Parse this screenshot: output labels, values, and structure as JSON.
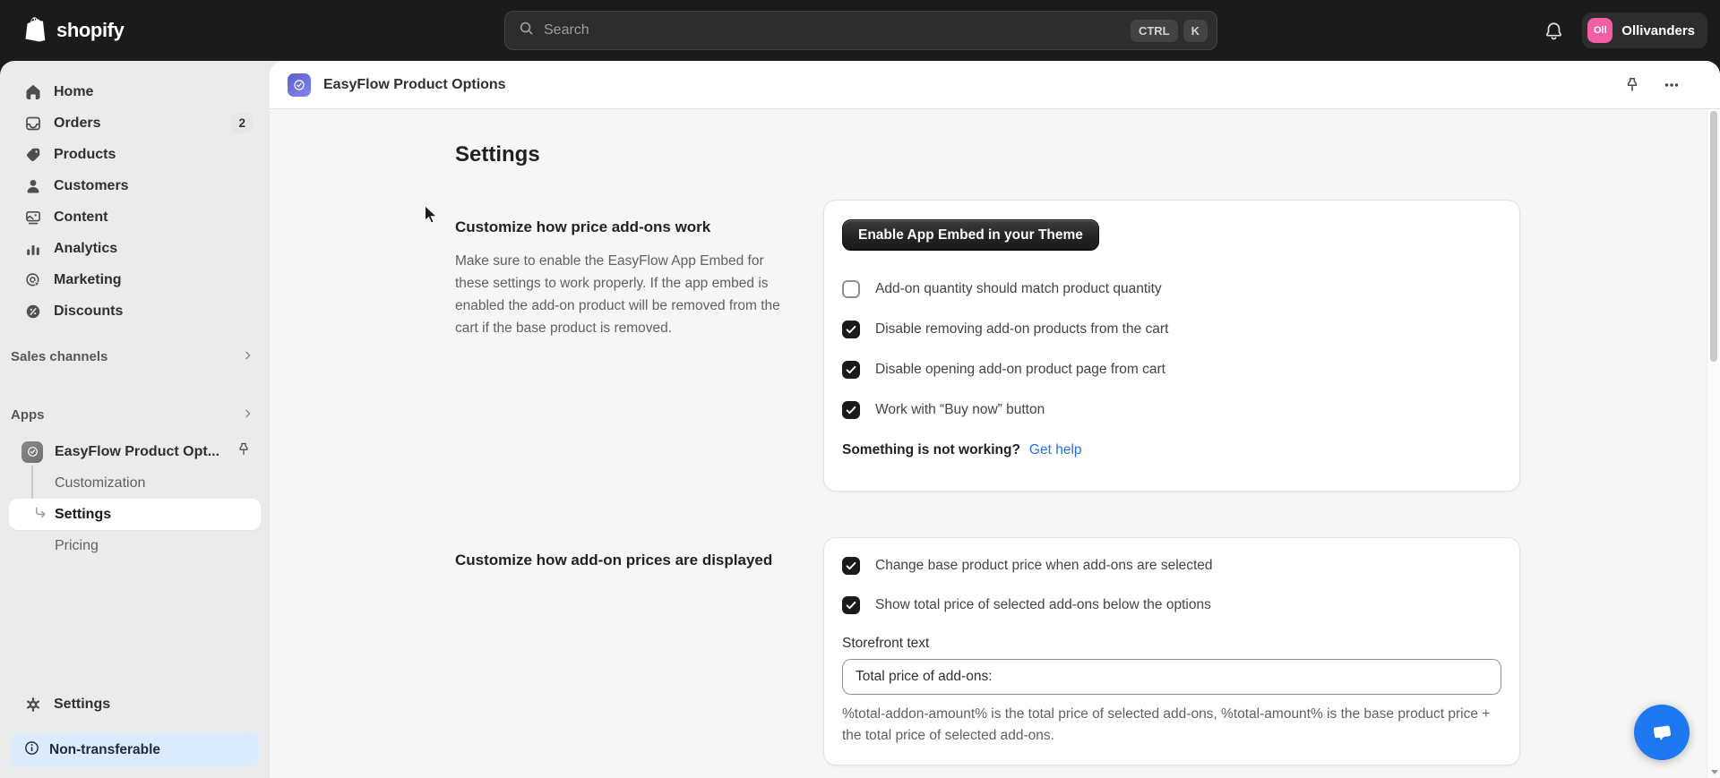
{
  "topbar": {
    "brand": "shopify",
    "search_placeholder": "Search",
    "shortcut_ctrl": "CTRL",
    "shortcut_k": "K",
    "store_initials": "Oll",
    "store_name": "Ollivanders"
  },
  "sidebar": {
    "items": [
      {
        "label": "Home"
      },
      {
        "label": "Orders",
        "badge": "2"
      },
      {
        "label": "Products"
      },
      {
        "label": "Customers"
      },
      {
        "label": "Content"
      },
      {
        "label": "Analytics"
      },
      {
        "label": "Marketing"
      },
      {
        "label": "Discounts"
      }
    ],
    "sales_channels_label": "Sales channels",
    "apps_label": "Apps",
    "app_name": "EasyFlow Product Opt...",
    "app_children": [
      {
        "label": "Customization",
        "selected": false
      },
      {
        "label": "Settings",
        "selected": true
      },
      {
        "label": "Pricing",
        "selected": false
      }
    ],
    "settings_label": "Settings",
    "banner_label": "Non-transferable"
  },
  "header": {
    "app_title": "EasyFlow Product Options"
  },
  "page": {
    "title": "Settings",
    "section1": {
      "heading": "Customize how price add-ons work",
      "description": "Make sure to enable the EasyFlow App Embed for these settings to work properly. If the app embed is enabled the add-on product will be removed from the cart if the base product is removed.",
      "button_label": "Enable App Embed in your Theme",
      "checkboxes": [
        {
          "label": "Add-on quantity should match product quantity",
          "checked": false
        },
        {
          "label": "Disable removing add-on products from the cart",
          "checked": true
        },
        {
          "label": "Disable opening add-on product page from cart",
          "checked": true
        },
        {
          "label": "Work with “Buy now” button",
          "checked": true
        }
      ],
      "help_question": "Something is not working?",
      "help_link": "Get help"
    },
    "section2": {
      "heading": "Customize how add-on prices are displayed",
      "checkboxes": [
        {
          "label": "Change base product price when add-ons are selected",
          "checked": true
        },
        {
          "label": "Show total price of selected add-ons below the options",
          "checked": true
        }
      ],
      "input_label": "Storefront text",
      "input_value": "Total price of add-ons:",
      "helper_text": "%total-addon-amount% is the total price of selected add-ons, %total-amount% is the base product price + the total price of selected add-ons."
    }
  },
  "colors": {
    "topbar_bg": "#1b1b1b",
    "sidebar_bg": "#ebebeb",
    "link_blue": "#2970e6",
    "avatar_pink": "#f25fa4",
    "chat_blue": "#1d78f2",
    "banner_blue_bg": "#dcebfb",
    "app_icon_purple": "#6a6fe0",
    "checked_checkbox": "#1a1a1a"
  }
}
